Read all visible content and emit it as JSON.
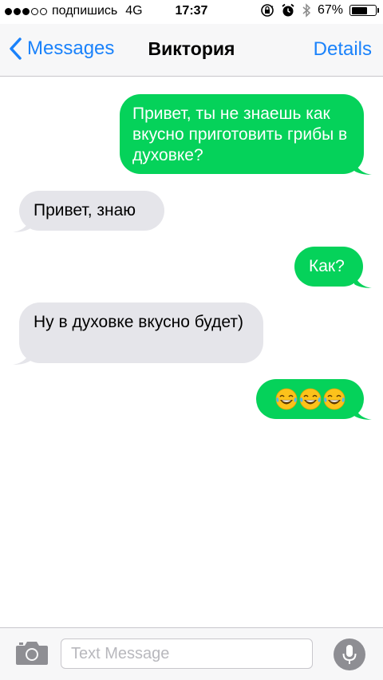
{
  "status_bar": {
    "carrier": "подпишись",
    "network": "4G",
    "time": "17:37",
    "battery_percent": "67%",
    "battery_level": 0.67,
    "signal_bars_filled": 3,
    "signal_bars_total": 5
  },
  "nav": {
    "back_label": "Messages",
    "title": "Виктория",
    "details_label": "Details"
  },
  "messages": [
    {
      "sender": "me",
      "text": "Привет, ты не знаешь как вкусно приготовить грибы в духовке?"
    },
    {
      "sender": "them",
      "text": "Привет, знаю"
    },
    {
      "sender": "me",
      "text": "Как?"
    },
    {
      "sender": "them",
      "text": "Ну в духовке вкусно будет)"
    },
    {
      "sender": "me",
      "text": "😂😂😂"
    }
  ],
  "input": {
    "placeholder": "Text Message"
  },
  "icons": {
    "camera": "camera-icon",
    "mic": "microphone-icon",
    "back": "chevron-left-icon",
    "alarm": "alarm-icon",
    "bluetooth": "bluetooth-icon",
    "rotation_lock": "rotation-lock-icon"
  },
  "colors": {
    "outgoing_bubble": "#05d25a",
    "incoming_bubble": "#e5e5ea",
    "accent": "#1a82fb"
  }
}
